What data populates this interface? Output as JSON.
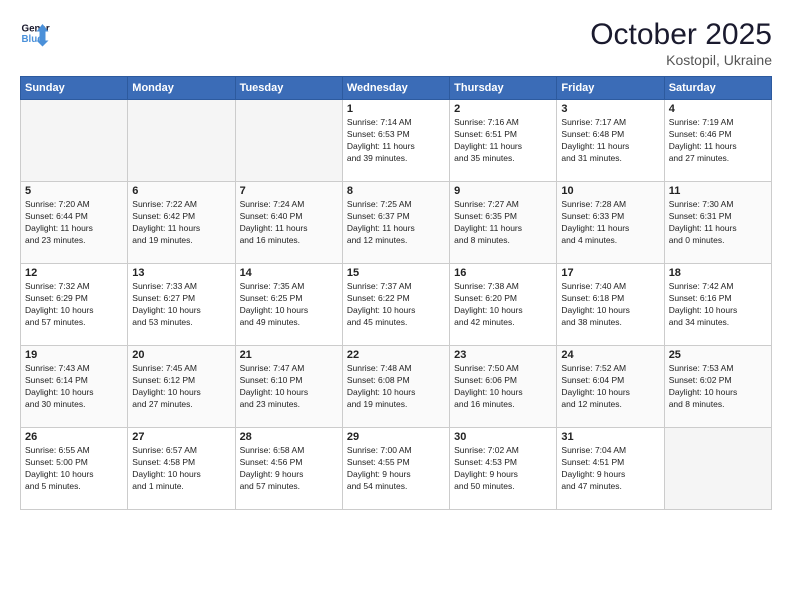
{
  "header": {
    "logo_line1": "General",
    "logo_line2": "Blue",
    "month": "October 2025",
    "location": "Kostopil, Ukraine"
  },
  "weekdays": [
    "Sunday",
    "Monday",
    "Tuesday",
    "Wednesday",
    "Thursday",
    "Friday",
    "Saturday"
  ],
  "weeks": [
    [
      {
        "day": "",
        "info": ""
      },
      {
        "day": "",
        "info": ""
      },
      {
        "day": "",
        "info": ""
      },
      {
        "day": "1",
        "info": "Sunrise: 7:14 AM\nSunset: 6:53 PM\nDaylight: 11 hours\nand 39 minutes."
      },
      {
        "day": "2",
        "info": "Sunrise: 7:16 AM\nSunset: 6:51 PM\nDaylight: 11 hours\nand 35 minutes."
      },
      {
        "day": "3",
        "info": "Sunrise: 7:17 AM\nSunset: 6:48 PM\nDaylight: 11 hours\nand 31 minutes."
      },
      {
        "day": "4",
        "info": "Sunrise: 7:19 AM\nSunset: 6:46 PM\nDaylight: 11 hours\nand 27 minutes."
      }
    ],
    [
      {
        "day": "5",
        "info": "Sunrise: 7:20 AM\nSunset: 6:44 PM\nDaylight: 11 hours\nand 23 minutes."
      },
      {
        "day": "6",
        "info": "Sunrise: 7:22 AM\nSunset: 6:42 PM\nDaylight: 11 hours\nand 19 minutes."
      },
      {
        "day": "7",
        "info": "Sunrise: 7:24 AM\nSunset: 6:40 PM\nDaylight: 11 hours\nand 16 minutes."
      },
      {
        "day": "8",
        "info": "Sunrise: 7:25 AM\nSunset: 6:37 PM\nDaylight: 11 hours\nand 12 minutes."
      },
      {
        "day": "9",
        "info": "Sunrise: 7:27 AM\nSunset: 6:35 PM\nDaylight: 11 hours\nand 8 minutes."
      },
      {
        "day": "10",
        "info": "Sunrise: 7:28 AM\nSunset: 6:33 PM\nDaylight: 11 hours\nand 4 minutes."
      },
      {
        "day": "11",
        "info": "Sunrise: 7:30 AM\nSunset: 6:31 PM\nDaylight: 11 hours\nand 0 minutes."
      }
    ],
    [
      {
        "day": "12",
        "info": "Sunrise: 7:32 AM\nSunset: 6:29 PM\nDaylight: 10 hours\nand 57 minutes."
      },
      {
        "day": "13",
        "info": "Sunrise: 7:33 AM\nSunset: 6:27 PM\nDaylight: 10 hours\nand 53 minutes."
      },
      {
        "day": "14",
        "info": "Sunrise: 7:35 AM\nSunset: 6:25 PM\nDaylight: 10 hours\nand 49 minutes."
      },
      {
        "day": "15",
        "info": "Sunrise: 7:37 AM\nSunset: 6:22 PM\nDaylight: 10 hours\nand 45 minutes."
      },
      {
        "day": "16",
        "info": "Sunrise: 7:38 AM\nSunset: 6:20 PM\nDaylight: 10 hours\nand 42 minutes."
      },
      {
        "day": "17",
        "info": "Sunrise: 7:40 AM\nSunset: 6:18 PM\nDaylight: 10 hours\nand 38 minutes."
      },
      {
        "day": "18",
        "info": "Sunrise: 7:42 AM\nSunset: 6:16 PM\nDaylight: 10 hours\nand 34 minutes."
      }
    ],
    [
      {
        "day": "19",
        "info": "Sunrise: 7:43 AM\nSunset: 6:14 PM\nDaylight: 10 hours\nand 30 minutes."
      },
      {
        "day": "20",
        "info": "Sunrise: 7:45 AM\nSunset: 6:12 PM\nDaylight: 10 hours\nand 27 minutes."
      },
      {
        "day": "21",
        "info": "Sunrise: 7:47 AM\nSunset: 6:10 PM\nDaylight: 10 hours\nand 23 minutes."
      },
      {
        "day": "22",
        "info": "Sunrise: 7:48 AM\nSunset: 6:08 PM\nDaylight: 10 hours\nand 19 minutes."
      },
      {
        "day": "23",
        "info": "Sunrise: 7:50 AM\nSunset: 6:06 PM\nDaylight: 10 hours\nand 16 minutes."
      },
      {
        "day": "24",
        "info": "Sunrise: 7:52 AM\nSunset: 6:04 PM\nDaylight: 10 hours\nand 12 minutes."
      },
      {
        "day": "25",
        "info": "Sunrise: 7:53 AM\nSunset: 6:02 PM\nDaylight: 10 hours\nand 8 minutes."
      }
    ],
    [
      {
        "day": "26",
        "info": "Sunrise: 6:55 AM\nSunset: 5:00 PM\nDaylight: 10 hours\nand 5 minutes."
      },
      {
        "day": "27",
        "info": "Sunrise: 6:57 AM\nSunset: 4:58 PM\nDaylight: 10 hours\nand 1 minute."
      },
      {
        "day": "28",
        "info": "Sunrise: 6:58 AM\nSunset: 4:56 PM\nDaylight: 9 hours\nand 57 minutes."
      },
      {
        "day": "29",
        "info": "Sunrise: 7:00 AM\nSunset: 4:55 PM\nDaylight: 9 hours\nand 54 minutes."
      },
      {
        "day": "30",
        "info": "Sunrise: 7:02 AM\nSunset: 4:53 PM\nDaylight: 9 hours\nand 50 minutes."
      },
      {
        "day": "31",
        "info": "Sunrise: 7:04 AM\nSunset: 4:51 PM\nDaylight: 9 hours\nand 47 minutes."
      },
      {
        "day": "",
        "info": ""
      }
    ]
  ]
}
